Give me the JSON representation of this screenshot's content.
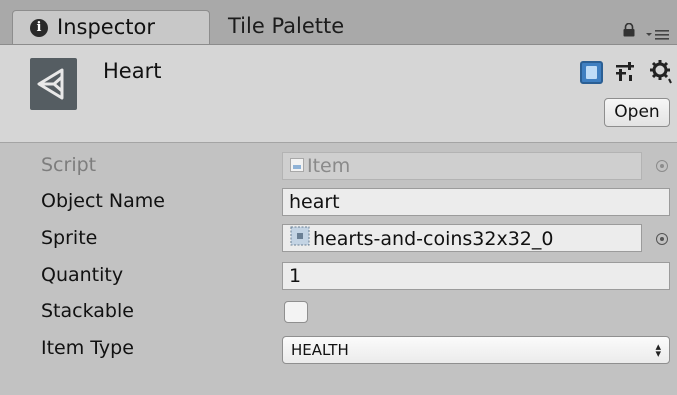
{
  "tabs": {
    "inspector": "Inspector",
    "tile_palette": "Tile Palette"
  },
  "header": {
    "object_name": "Heart",
    "open_button": "Open"
  },
  "fields": {
    "script": {
      "label": "Script",
      "value": "Item"
    },
    "object_name": {
      "label": "Object Name",
      "value": "heart"
    },
    "sprite": {
      "label": "Sprite",
      "value": "hearts-and-coins32x32_0"
    },
    "quantity": {
      "label": "Quantity",
      "value": "1"
    },
    "stackable": {
      "label": "Stackable",
      "checked": false
    },
    "item_type": {
      "label": "Item Type",
      "value": "HEALTH"
    }
  },
  "icons": {
    "tab": "info-icon",
    "window": [
      "lock-icon",
      "menu-icon"
    ],
    "header": [
      "unity-logo-icon",
      "help-icon",
      "preset-icon",
      "gear-icon"
    ]
  },
  "colors": {
    "tab_bar": "#a9a9a9",
    "header_bg": "#d6d6d6",
    "body_bg": "#c2c2c2",
    "help_icon": "#3f7fc1"
  }
}
